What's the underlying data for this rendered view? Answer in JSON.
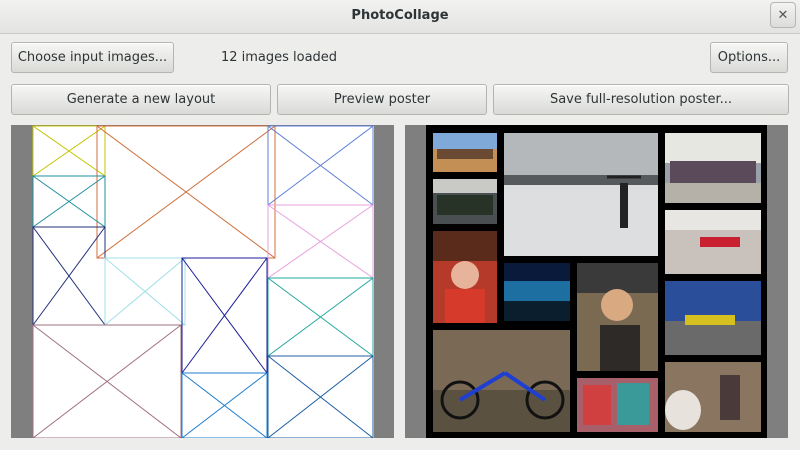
{
  "window": {
    "title": "PhotoCollage",
    "close_glyph": "✕"
  },
  "toolbar": {
    "choose_label": "Choose input images...",
    "status_text": "12 images loaded",
    "options_label": "Options...",
    "generate_label": "Generate a new layout",
    "preview_label": "Preview poster",
    "save_label": "Save full-resolution poster..."
  },
  "layout_preview": {
    "cells": 12,
    "colors": [
      "#c4c400",
      "#d06f3e",
      "#5f7fd8",
      "#1f8f9e",
      "#e8a0e0",
      "#23307a",
      "#a0e0e8",
      "#1c1c99",
      "#22a8a0",
      "#a07080",
      "#1f7fd0",
      "#1f5fa0"
    ]
  },
  "poster_preview": {
    "photos": [
      {
        "name": "beach-group",
        "color": "#c48f55"
      },
      {
        "name": "snow-jump",
        "color": "#dcdedf"
      },
      {
        "name": "monument-group",
        "color": "#9aa0a8"
      },
      {
        "name": "plaza-group",
        "color": "#4a4f52"
      },
      {
        "name": "baby-portrait",
        "color": "#b53a2a"
      },
      {
        "name": "wristband",
        "color": "#c9c2bc"
      },
      {
        "name": "night-show",
        "color": "#1d6fa2"
      },
      {
        "name": "sunglasses-portrait",
        "color": "#7a6a52"
      },
      {
        "name": "parade",
        "color": "#2a4e9a"
      },
      {
        "name": "blue-bicycle",
        "color": "#5b5140"
      },
      {
        "name": "street-art",
        "color": "#c84a5a"
      },
      {
        "name": "cave-figure",
        "color": "#8a7560"
      }
    ]
  }
}
